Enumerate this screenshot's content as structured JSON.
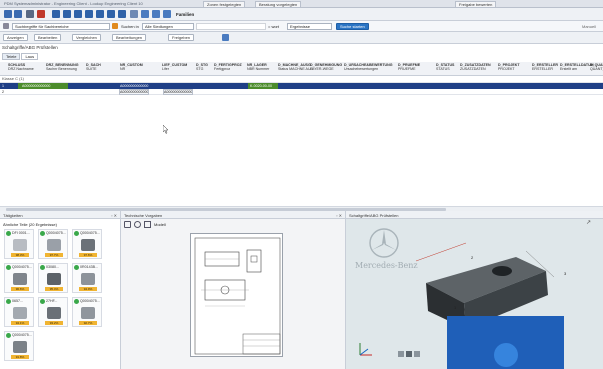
{
  "window": {
    "title": "PDM Systemadministrator - Engineering Client - Lookup Engineering Client 10",
    "tabs": [
      "Zonen festgelegten",
      "Beratung vorgelegten",
      "Freigabe bewerten"
    ]
  },
  "toolbar1": {
    "title_label": "Familien"
  },
  "toolbar2": {
    "search_scope": "Suchbegriffe für Sachbereiche",
    "search_label": "Suchen in",
    "search_in_value": "Alle Siedlungen",
    "word_label": "= wort",
    "result_select": "Ergebnisse",
    "search_button": "Suche starten",
    "right_label": "Manuell"
  },
  "toolbar3": {
    "buttons": [
      "Anzeigen",
      "Bearbeiten",
      "Vergleichen",
      "Bearbeitungen",
      "Freigeben"
    ]
  },
  "section": {
    "title": "Schaltgriffe/ABG Prüfstellen",
    "tabs": [
      "Teiele",
      "Laus"
    ]
  },
  "grid": {
    "columns": [
      [
        "SCHLUSS",
        "DRZ Nachname"
      ],
      [
        "DRZ_BENENNUNG",
        "Sachnr Benennung"
      ],
      [
        "D_SACH",
        "SUITE"
      ],
      [
        "NR_CUSTOM",
        "NR"
      ],
      [
        "LIEF_CUSTOM",
        "Lifer"
      ],
      [
        "D_STG",
        "STG"
      ],
      [
        "D_FERTIGPROZ",
        "Fertigproz"
      ],
      [
        "NR_LAGER",
        "NBR Nummer"
      ],
      [
        "D_MACHNE_AUSG",
        "Status MACHNE AUS"
      ],
      [
        "D_GENEHMIGUNG",
        "LAYER-WEGE"
      ],
      [
        "D_URSACHE&BEWERTUNG",
        "Ursachebewertungen"
      ],
      [
        "D_PRUEFME",
        "PRUEFME"
      ],
      [
        "D_STATUS",
        "STATUS"
      ],
      [
        "D_ZUSATZDATEN",
        "ZUSATZDATEN"
      ],
      [
        "D_PROJEKT",
        "PROJEKT"
      ],
      [
        "D_ERSTELLER",
        "ERSTELLER"
      ],
      [
        "D_ERSTELLDATUM",
        "Erstellt am"
      ],
      [
        "D_QUANT",
        "QUANT_R"
      ]
    ],
    "subheader": "Klasse C (1)",
    "selected_row": {
      "index": "1",
      "cells": [
        "A0000000000000",
        "A0000000000000",
        "K-0020-00-00"
      ]
    },
    "data_row": {
      "index": "2",
      "cells": [
        "A0000000000000",
        "A0000000000000"
      ]
    }
  },
  "left_panel": {
    "title": "Tätigkeiten",
    "subtitle": "Ähnliche Teile (20 Ergebnisse)",
    "tiles": [
      {
        "label": "DFI 0001...",
        "tag": "98.3%"
      },
      {
        "label": "Q0004075...",
        "tag": "97.7%"
      },
      {
        "label": "Q0004075...",
        "tag": "97.6%"
      },
      {
        "label": "Q0004075...",
        "tag": "96.6%"
      },
      {
        "label": "03080...",
        "tag": "95.4%"
      },
      {
        "label": "0R0143B...",
        "tag": "94.9%"
      },
      {
        "label": "0657...",
        "tag": "94.1%"
      },
      {
        "label": "27HF...",
        "tag": "93.2%"
      },
      {
        "label": "Q0004075...",
        "tag": "92.7%"
      },
      {
        "label": "Q0004075...",
        "tag": "91.8%"
      }
    ]
  },
  "mid_panel": {
    "title": "Technische Vorgaben",
    "tool_label": "Modell"
  },
  "right_panel": {
    "title": "Schaltgriffe/ABG Prüfstellen",
    "brand_text": "Mercedes-Benz",
    "dimension_labels": [
      "2",
      "1",
      "3"
    ]
  }
}
